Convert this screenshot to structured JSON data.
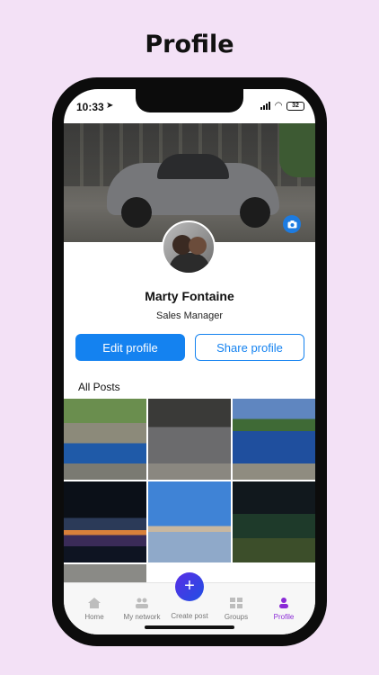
{
  "page": {
    "heading": "Profile"
  },
  "status_bar": {
    "time": "10:33",
    "battery": "32"
  },
  "profile": {
    "name": "Marty Fontaine",
    "role": "Sales Manager",
    "edit_label": "Edit profile",
    "share_label": "Share profile",
    "posts_heading": "All Posts"
  },
  "tabbar": {
    "items": [
      {
        "label": "Home",
        "icon": "home-icon"
      },
      {
        "label": "My network",
        "icon": "network-icon"
      },
      {
        "label": "Create post",
        "icon": "plus-icon"
      },
      {
        "label": "Groups",
        "icon": "groups-icon"
      },
      {
        "label": "Profile",
        "icon": "profile-icon"
      }
    ]
  },
  "colors": {
    "accent": "#1482f0",
    "active_tab": "#8a2ad6",
    "background": "#f3e1f6"
  }
}
